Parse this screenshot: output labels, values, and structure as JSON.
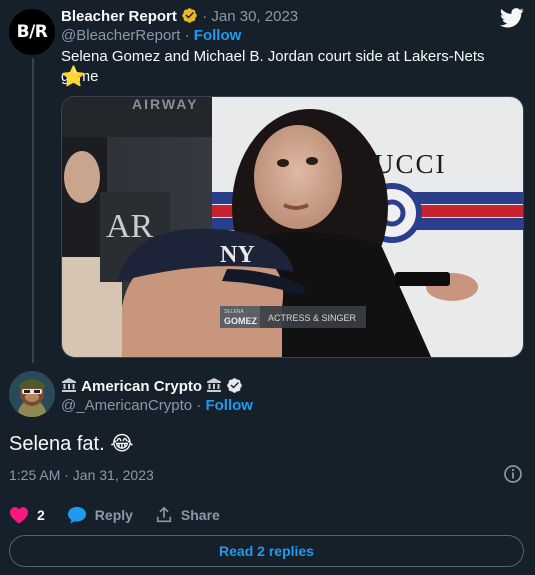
{
  "tweet": {
    "author_name": "Bleacher Report",
    "avatar_text": "B/R",
    "date": "Jan 30, 2023",
    "handle": "@BleacherReport",
    "follow_label": "Follow",
    "text": "Selena Gomez and Michael B. Jordan court side at Lakers-Nets game",
    "emoji": "⭐",
    "media": {
      "background_sign_text": "AIRWAY",
      "left_sign_text": "AR\nAY",
      "shirt_brand_text": "UCCI",
      "cap_logo_text": "NY",
      "caption_name": "GOMEZ",
      "caption_name_small": "SELENA",
      "caption_role": "ACTRESS & SINGER"
    }
  },
  "reply": {
    "author_name": "American Crypto",
    "handle": "@_AmericanCrypto",
    "follow_label": "Follow",
    "text": "Selena fat.",
    "emoji": "😂",
    "timestamp": "1:25 AM · Jan 31, 2023",
    "actions": {
      "like_count": "2",
      "reply_label": "Reply",
      "share_label": "Share"
    },
    "read_replies_label": "Read 2 replies"
  },
  "colors": {
    "background": "#15202b",
    "accent": "#1d9bf0",
    "like": "#f91880",
    "muted": "#8b98a5"
  },
  "icons": [
    "twitter-bird-icon",
    "verified-badge-icon",
    "bank-icon",
    "info-icon",
    "heart-icon",
    "speech-bubble-icon",
    "share-icon",
    "star-emoji",
    "tears-of-joy-emoji"
  ]
}
